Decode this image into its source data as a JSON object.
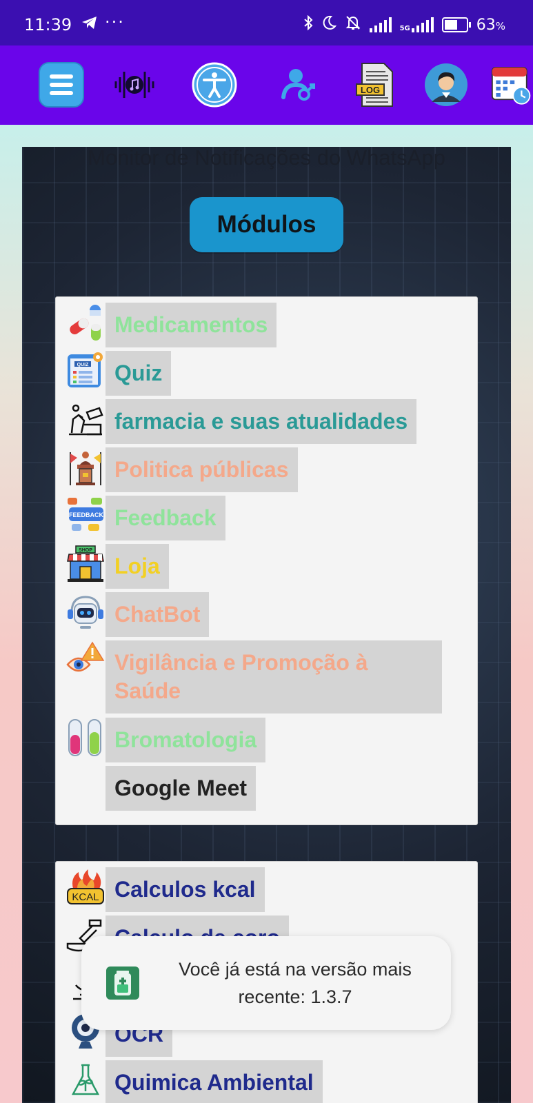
{
  "status_bar": {
    "time": "11:39",
    "dots": "···",
    "network": "5G",
    "battery_percent": "63",
    "battery_unit": "%",
    "icons": [
      "telegram-icon",
      "bluetooth-icon",
      "moon-icon",
      "bell-off-icon",
      "signal-icon",
      "5g-signal-icon",
      "battery-icon"
    ]
  },
  "toolbar": {
    "icons": [
      "menu-icon",
      "music-icon",
      "accessibility-icon",
      "user-gender-icon",
      "log-file-icon",
      "avatar-icon",
      "calendar-clock-icon"
    ],
    "log_label": "LOG",
    "colors": {
      "bar": "#6a05ea",
      "status": "#3b0fb1",
      "menu_bg": "#3fa8e8"
    }
  },
  "main": {
    "monitor_title": "Monitor de Notificações do WhatsApp",
    "modules_label": "Módulos",
    "modules_color": "#1a95cd"
  },
  "panel1": {
    "items": [
      {
        "label": "Medicamentos",
        "color": "#8fe39b",
        "icon": "pills-icon"
      },
      {
        "label": "Quiz",
        "color": "#2a9a96",
        "icon": "quiz-icon"
      },
      {
        "label": "farmacia e suas atualidades",
        "color": "#2a9a96",
        "icon": "pharmacy-icon"
      },
      {
        "label": "Politica públicas",
        "color": "#f4a88a",
        "icon": "podium-icon"
      },
      {
        "label": "Feedback",
        "color": "#8fe39b",
        "icon": "feedback-icon"
      },
      {
        "label": "Loja",
        "color": "#f2d024",
        "icon": "shop-icon"
      },
      {
        "label": "ChatBot",
        "color": "#f4a88a",
        "icon": "robot-icon"
      },
      {
        "label": "Vigilância e Promoção à Saúde",
        "color": "#f4a88a",
        "icon": "eye-warning-icon"
      },
      {
        "label": "Bromatologia",
        "color": "#8fe39b",
        "icon": "test-tubes-icon"
      },
      {
        "label": "Google Meet",
        "color": "#222222",
        "icon": ""
      }
    ]
  },
  "panel2": {
    "items": [
      {
        "label": "Calculos kcal",
        "color": "#1f2a8c",
        "icon": "kcal-icon"
      },
      {
        "label": "Calculo de coro",
        "color": "#1f2a8c",
        "icon": "dropper-icon"
      },
      {
        "label": "",
        "color": "#1f2a8c",
        "icon": "microscope-icon"
      },
      {
        "label": "OCR",
        "color": "#1f2a8c",
        "icon": "webcam-icon"
      },
      {
        "label": "Quimica Ambiental",
        "color": "#1f2a8c",
        "icon": "flask-plant-icon"
      }
    ]
  },
  "toast": {
    "message": "Você já está na versão mais recente: 1.3.7",
    "icon": "app-battery-icon"
  }
}
